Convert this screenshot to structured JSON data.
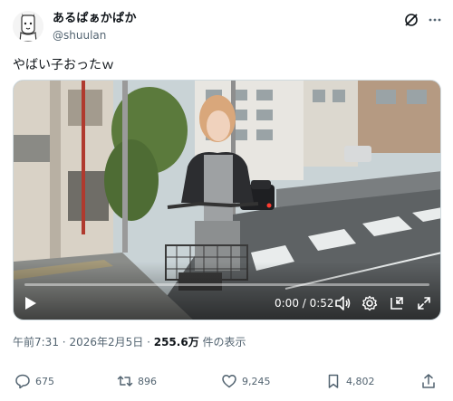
{
  "post": {
    "display_name": "あるぱぁかぱか",
    "handle": "@shuulan",
    "text": "やばい子おったｗ"
  },
  "video": {
    "time_display": "0:00 / 0:52",
    "progress": 0.0
  },
  "meta": {
    "time": "午前7:31",
    "separator1": "·",
    "date": "2026年2月5日",
    "separator2": "·",
    "views_count": "255.6万",
    "views_label": "件の表示"
  },
  "actions": {
    "replies": "675",
    "reposts": "896",
    "likes": "9,245",
    "bookmarks": "4,802"
  },
  "icons": [
    "avatar",
    "grok-icon",
    "more-icon",
    "play-icon",
    "volume-icon",
    "settings-icon",
    "pip-icon",
    "fullscreen-icon",
    "reply-icon",
    "repost-icon",
    "like-icon",
    "bookmark-icon",
    "share-icon"
  ]
}
